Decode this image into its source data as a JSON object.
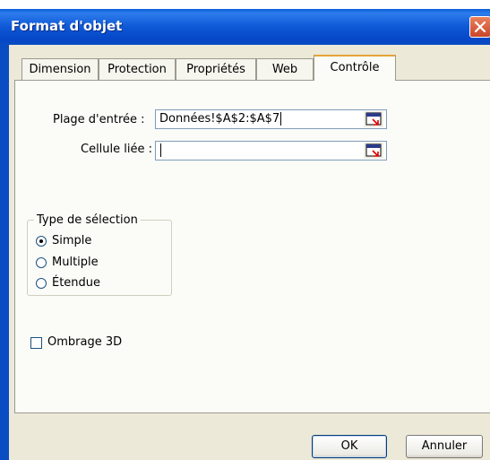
{
  "window": {
    "title": "Format d'objet"
  },
  "tabs": [
    {
      "label": "Dimension"
    },
    {
      "label": "Protection"
    },
    {
      "label": "Propriétés"
    },
    {
      "label": "Web"
    },
    {
      "label": "Contrôle"
    }
  ],
  "active_tab": "Contrôle",
  "control": {
    "input_range_label": "Plage d'entrée :",
    "input_range_value": "Données!$A$2:$A$7",
    "linked_cell_label": "Cellule liée :",
    "linked_cell_value": ""
  },
  "selection_type": {
    "legend": "Type de sélection",
    "options": [
      {
        "label": "Simple",
        "selected": true
      },
      {
        "label": "Multiple",
        "selected": false
      },
      {
        "label": "Étendue",
        "selected": false
      }
    ]
  },
  "shading": {
    "label": "Ombrage 3D",
    "checked": false
  },
  "buttons": {
    "ok": "OK",
    "cancel": "Annuler"
  }
}
